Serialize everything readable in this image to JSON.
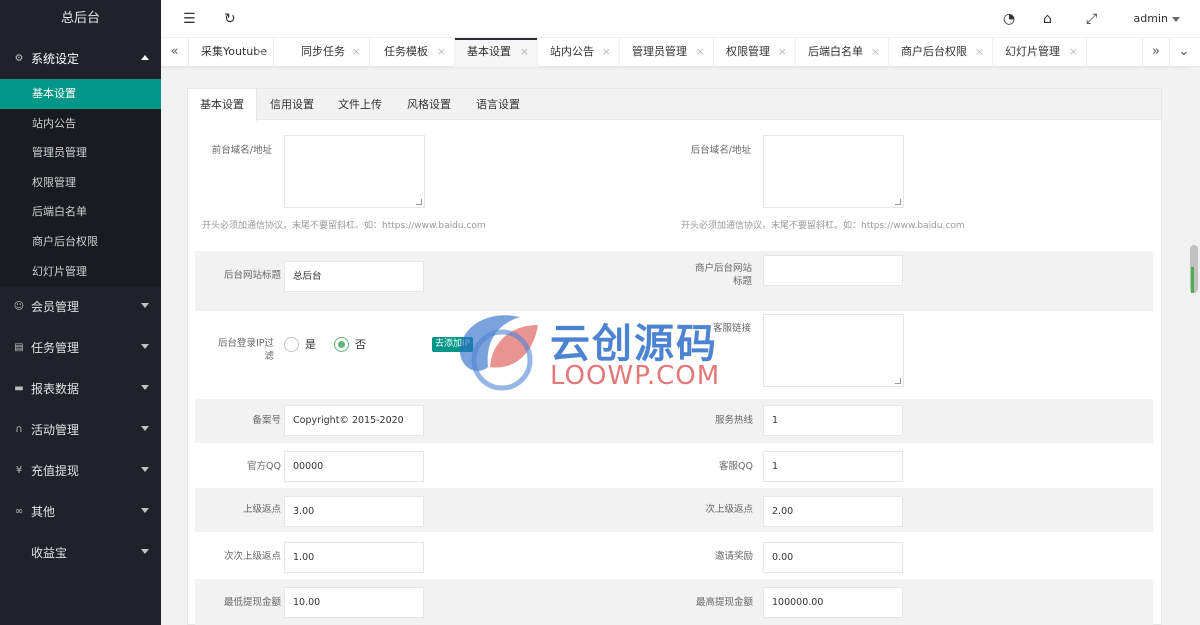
{
  "app": {
    "title": "总后台"
  },
  "sidebar": {
    "sections": [
      {
        "label": "系统设定",
        "icon": "gear-icon",
        "open": true
      },
      {
        "label": "会员管理",
        "icon": "user-icon"
      },
      {
        "label": "任务管理",
        "icon": "document-icon"
      },
      {
        "label": "报表数据",
        "icon": "chart-icon"
      },
      {
        "label": "活动管理",
        "icon": "headset-icon"
      },
      {
        "label": "充值提现",
        "icon": "yen-icon"
      },
      {
        "label": "其他",
        "icon": "infinity-icon"
      },
      {
        "label": "收益宝",
        "icon": ""
      }
    ],
    "sub_items": [
      "基本设置",
      "站内公告",
      "管理员管理",
      "权限管理",
      "后端白名单",
      "商户后台权限",
      "幻灯片管理"
    ]
  },
  "header": {
    "user": "admin"
  },
  "tabs": [
    "采集Youtube",
    "同步任务",
    "任务模板",
    "基本设置",
    "站内公告",
    "管理员管理",
    "权限管理",
    "后端白名单",
    "商户后台权限",
    "幻灯片管理"
  ],
  "form_tabs": [
    "基本设置",
    "信用设置",
    "文件上传",
    "风格设置",
    "语言设置"
  ],
  "form": {
    "front_domain_label": "前台域名/地址",
    "back_domain_label": "后台域名/地址",
    "domain_hint": "开头必须加通信协议，末尾不要留斜杠。如：https://www.baidu.com",
    "site_title_label": "后台网站标题",
    "site_title_value": "总后台",
    "merchant_title_label": "商户后台网站标题",
    "merchant_title_value": "",
    "ip_filter_label": "后台登录IP过滤",
    "radio_yes": "是",
    "radio_no": "否",
    "add_ip": "去添加IP",
    "customer_link_label": "客服链接",
    "record_label": "备案号",
    "record_value": "Copyright© 2015-2020",
    "hotline_label": "服务热线",
    "hotline_value": "1",
    "qq_label": "官方QQ",
    "qq_value": "00000",
    "service_qq_label": "客服QQ",
    "service_qq_value": "1",
    "upper_rebate_label": "上级返点",
    "upper_rebate_value": "3.00",
    "second_rebate_label": "次上级返点",
    "second_rebate_value": "2.00",
    "third_rebate_label": "次次上级返点",
    "third_rebate_value": "1.00",
    "invite_reward_label": "邀请奖励",
    "invite_reward_value": "0.00",
    "min_withdraw_label": "最低提现金额",
    "min_withdraw_value": "10.00",
    "max_withdraw_label": "最高提现金额",
    "max_withdraw_value": "100000.00"
  },
  "watermark": {
    "cn": "云创源码",
    "en": "LOOWP.COM"
  }
}
